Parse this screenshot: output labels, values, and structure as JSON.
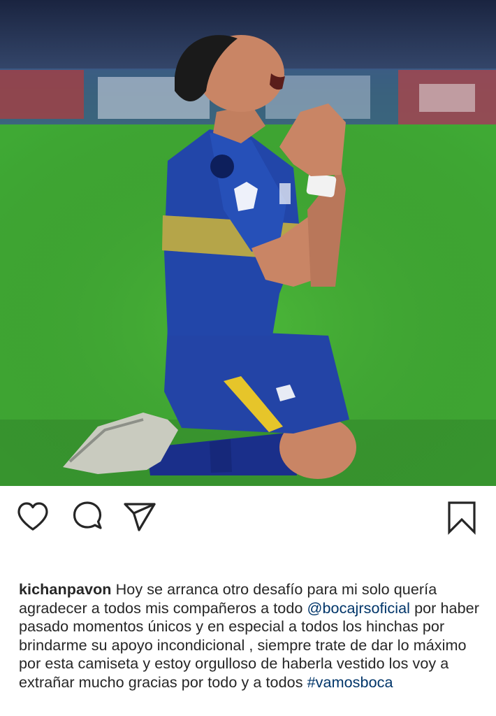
{
  "post": {
    "photo_alt": "photo",
    "actions": {
      "like_icon": "heart-outline",
      "comment_icon": "speech-bubble-outline",
      "share_icon": "paper-plane-outline",
      "save_icon": "bookmark-outline"
    },
    "caption": {
      "username": "kichanpavon",
      "text_1": " Hoy se arranca otro desafío para mi solo quería agradecer a todos mis compañeros a todo ",
      "mention": "@bocajrsoficial",
      "text_2": " por haber pasado momentos únicos y en especial a todos los hinchas por brindarme su apoyo incondicional , siempre trate de dar lo máximo por esta camiseta y estoy orgulloso de haberla vestido los voy a extrañar mucho gracias por todo y a todos ",
      "hashtag": "#vamosboca"
    },
    "colors": {
      "text": "#262626",
      "link": "#003569",
      "jersey_blue": "#1f3f9e",
      "jersey_yellow": "#e6c52a",
      "grass": "#3fa934"
    }
  }
}
